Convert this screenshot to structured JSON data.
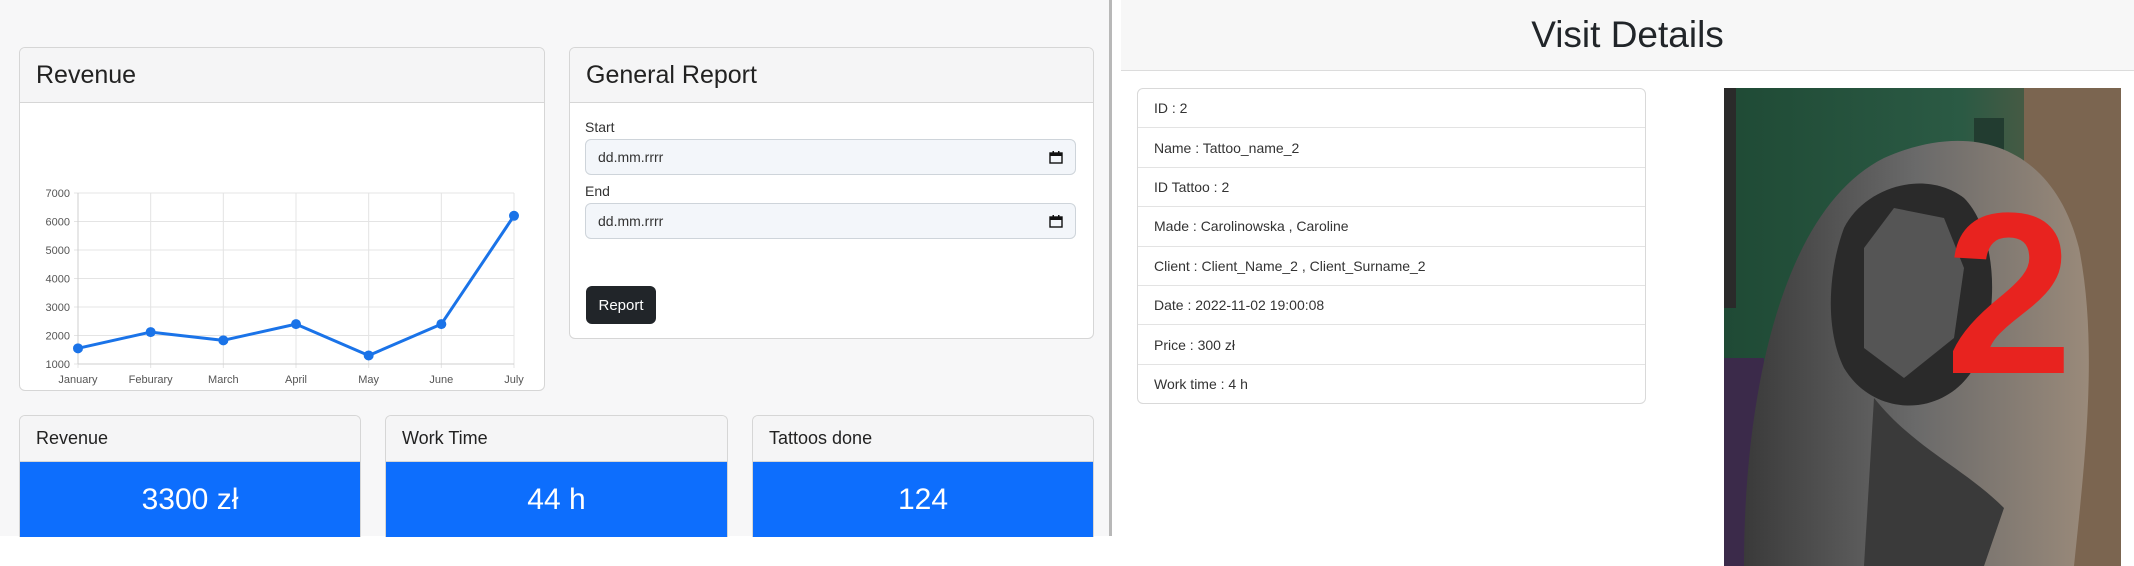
{
  "revenue_card": {
    "title": "Revenue"
  },
  "general_report": {
    "title": "General Report",
    "start_label": "Start",
    "start_value": "dd.mm.rrrr",
    "end_label": "End",
    "end_value": "dd.mm.rrrr",
    "report_button": "Report"
  },
  "stats": [
    {
      "label": "Revenue",
      "value": "3300 zł"
    },
    {
      "label": "Work Time",
      "value": "44 h"
    },
    {
      "label": "Tattoos done",
      "value": "124"
    }
  ],
  "visit": {
    "title": "Visit Details",
    "rows": [
      "ID : 2",
      "Name : Tattoo_name_2",
      "ID Tattoo : 2",
      "Made : Carolinowska , Caroline",
      "Client : Client_Name_2 , Client_Surname_2",
      "Date : 2022-11-02 19:00:08",
      "Price : 300 zł",
      "Work time : 4 h"
    ],
    "photo_number": "2"
  },
  "colors": {
    "accent": "#0d6efd",
    "dark_button": "#212529",
    "line_series": "#1a73e8",
    "photo_number": "#e8231f"
  },
  "chart_data": {
    "type": "line",
    "categories": [
      "January",
      "Feburary",
      "March",
      "April",
      "May",
      "June",
      "July"
    ],
    "series": [
      {
        "values": [
          1550,
          2120,
          1830,
          2400,
          1300,
          2400,
          6200
        ]
      }
    ],
    "y_ticks": [
      1000,
      2000,
      3000,
      4000,
      5000,
      6000,
      7000
    ],
    "ylim": [
      1000,
      7000
    ],
    "grid": true,
    "legend": "none"
  }
}
